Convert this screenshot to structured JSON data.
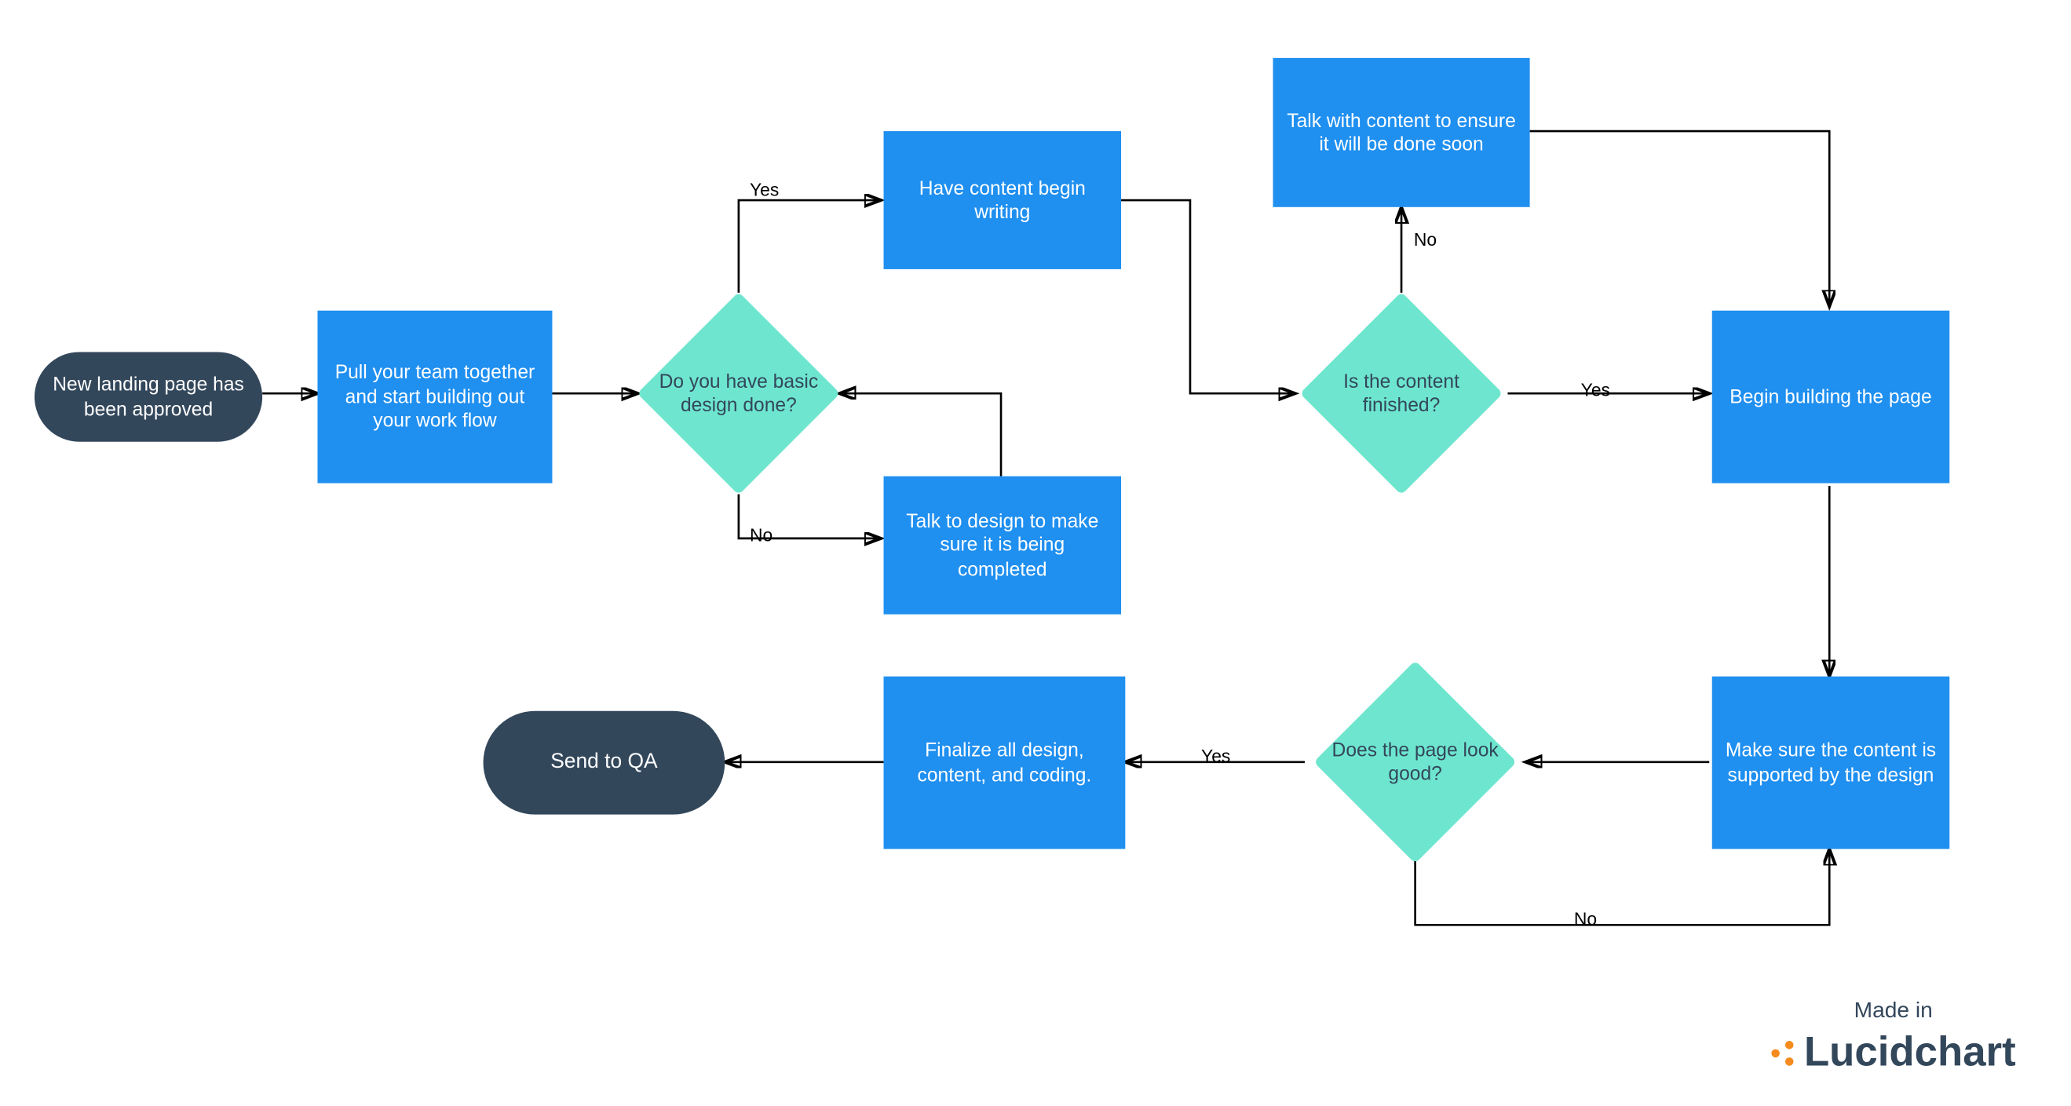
{
  "nodes": {
    "start": {
      "text": "New landing page has been approved"
    },
    "pull_team": {
      "text": "Pull your team together and start building out your work flow"
    },
    "basic_design": {
      "text": "Do you have basic design done?"
    },
    "have_content": {
      "text": "Have content begin writing"
    },
    "talk_design": {
      "text": "Talk to design to make sure it is being completed"
    },
    "talk_content": {
      "text": "Talk with content to ensure it will be done soon"
    },
    "content_done": {
      "text": "Is the content finished?"
    },
    "begin_build": {
      "text": "Begin building the page"
    },
    "make_sure": {
      "text": "Make sure the content is supported by the design"
    },
    "look_good": {
      "text": "Does the page look good?"
    },
    "finalize": {
      "text": "Finalize all design, content, and coding."
    },
    "send_qa": {
      "text": "Send to QA"
    }
  },
  "edge_labels": {
    "yes1": "Yes",
    "no1": "No",
    "yes2": "Yes",
    "no2": "No",
    "yes3": "Yes",
    "no3": "No"
  },
  "footer": {
    "made_in": "Made in",
    "brand": "Lucidchart"
  },
  "colors": {
    "process": "#1f8ff0",
    "decision": "#6ee6cf",
    "terminator": "#33475b"
  }
}
